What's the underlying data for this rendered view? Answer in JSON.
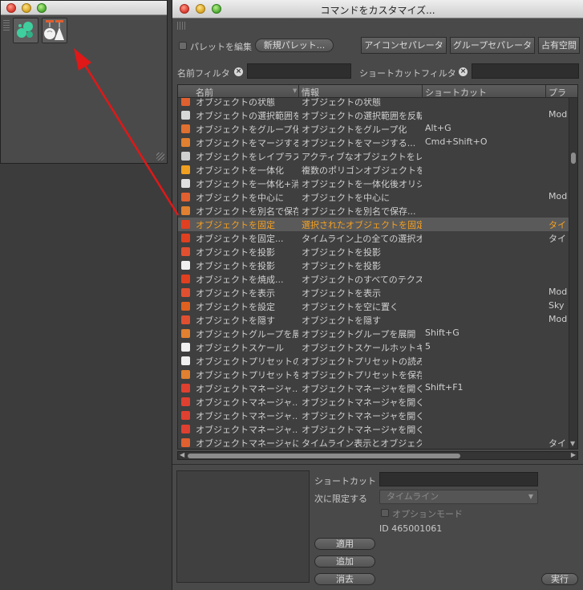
{
  "palette_window": {
    "buttons": [
      "blob-icon",
      "lamp-icon"
    ]
  },
  "dialog": {
    "title": "コマンドをカスタマイズ...",
    "edit_palette_label": "パレットを編集",
    "new_palette_button": "新規パレット...",
    "icon_separator_button": "アイコンセパレータ",
    "group_separator_button": "グループセパレータ",
    "space_button": "占有空間",
    "name_filter_label": "名前フィルタ",
    "shortcut_filter_label": "ショートカットフィルタ",
    "name_filter_value": "",
    "shortcut_filter_value": ""
  },
  "table": {
    "columns": [
      "名前",
      "情報",
      "ショートカット",
      "プラ"
    ],
    "rows": [
      {
        "name": "オブジェクトの状態",
        "info": "オブジェクトの状態",
        "shortcut": "",
        "extra": "",
        "icon": "#e06030"
      },
      {
        "name": "オブジェクトの選択範囲を",
        "info": "オブジェクトの選択範囲を反転",
        "shortcut": "",
        "extra": "Mod",
        "icon": "#d8d8d8"
      },
      {
        "name": "オブジェクトをグループ化",
        "info": "オブジェクトをグループ化",
        "shortcut": "Alt+G",
        "extra": "",
        "icon": "#e07030"
      },
      {
        "name": "オブジェクトをマージする",
        "info": "オブジェクトをマージする...",
        "shortcut": "Cmd+Shift+O",
        "extra": "",
        "icon": "#e08030"
      },
      {
        "name": "オブジェクトをレイプラス",
        "info": "アクティブなオブジェクトをレ",
        "shortcut": "",
        "extra": "",
        "icon": "#d0d0d0"
      },
      {
        "name": "オブジェクトを一体化",
        "info": "複数のポリゴンオブジェクトを",
        "shortcut": "",
        "extra": "",
        "icon": "#f0a020"
      },
      {
        "name": "オブジェクトを一体化+消",
        "info": "オブジェクトを一体化後オリジ",
        "shortcut": "",
        "extra": "",
        "icon": "#e0e0e0"
      },
      {
        "name": "オブジェクトを中心に",
        "info": "オブジェクトを中心に",
        "shortcut": "",
        "extra": "Mod",
        "icon": "#e06030"
      },
      {
        "name": "オブジェクトを別名で保存",
        "info": "オブジェクトを別名で保存...",
        "shortcut": "",
        "extra": "",
        "icon": "#e08030"
      },
      {
        "name": "オブジェクトを固定",
        "info": "選択されたオブジェクトを固定",
        "shortcut": "",
        "extra": "タイ",
        "icon": "#e04020",
        "selected": true
      },
      {
        "name": "オブジェクトを固定...",
        "info": "タイムライン上の全ての選択オ",
        "shortcut": "",
        "extra": "タイ",
        "icon": "#e04020"
      },
      {
        "name": "オブジェクトを投影",
        "info": "オブジェクトを投影",
        "shortcut": "",
        "extra": "",
        "icon": "#e05030"
      },
      {
        "name": "オブジェクトを投影",
        "info": "オブジェクトを投影",
        "shortcut": "",
        "extra": "",
        "icon": "#f0f0f0"
      },
      {
        "name": "オブジェクトを焼成...",
        "info": "オブジェクトのすべてのテクス",
        "shortcut": "",
        "extra": "",
        "icon": "#e04020"
      },
      {
        "name": "オブジェクトを表示",
        "info": "オブジェクトを表示",
        "shortcut": "",
        "extra": "Mod",
        "icon": "#e05030"
      },
      {
        "name": "オブジェクトを設定",
        "info": "オブジェクトを空に置く",
        "shortcut": "",
        "extra": "Sky",
        "icon": "#e06020"
      },
      {
        "name": "オブジェクトを隠す",
        "info": "オブジェクトを隠す",
        "shortcut": "",
        "extra": "Mod",
        "icon": "#e05030"
      },
      {
        "name": "オブジェクトグループを展",
        "info": "オブジェクトグループを展開",
        "shortcut": "Shift+G",
        "extra": "",
        "icon": "#e08030"
      },
      {
        "name": "オブジェクトスケール",
        "info": "オブジェクトスケールホットキ",
        "shortcut": "5",
        "extra": "",
        "icon": "#f0f0f0"
      },
      {
        "name": "オブジェクトプリセットの",
        "info": "オブジェクトプリセットの読み",
        "shortcut": "",
        "extra": "",
        "icon": "#f0f0f0"
      },
      {
        "name": "オブジェクトプリセットを",
        "info": "オブジェクトプリセットを保存",
        "shortcut": "",
        "extra": "",
        "icon": "#e08030"
      },
      {
        "name": "オブジェクトマネージャ...",
        "info": "オブジェクトマネージャを開く",
        "shortcut": "Shift+F1",
        "extra": "",
        "icon": "#e04030"
      },
      {
        "name": "オブジェクトマネージャ...",
        "info": "オブジェクトマネージャを開く",
        "shortcut": "",
        "extra": "",
        "icon": "#e04030"
      },
      {
        "name": "オブジェクトマネージャ...",
        "info": "オブジェクトマネージャを開く",
        "shortcut": "",
        "extra": "",
        "icon": "#e04030"
      },
      {
        "name": "オブジェクトマネージャ...",
        "info": "オブジェクトマネージャを開く",
        "shortcut": "",
        "extra": "",
        "icon": "#e04030"
      },
      {
        "name": "オブジェクトマネージャに",
        "info": "タイムライン表示とオブジェク",
        "shortcut": "",
        "extra": "タイ",
        "icon": "#e06030"
      }
    ]
  },
  "bottom": {
    "shortcut_label": "ショートカット",
    "restrict_label": "次に限定する",
    "restrict_value": "タイムライン",
    "option_mode_label": "オプションモード",
    "id_text": "ID 465001061",
    "apply_button": "適用",
    "add_button": "追加",
    "delete_button": "消去",
    "execute_button": "実行"
  },
  "colors": {
    "selected_text": "#f5a020",
    "arrow": "#e01818"
  }
}
